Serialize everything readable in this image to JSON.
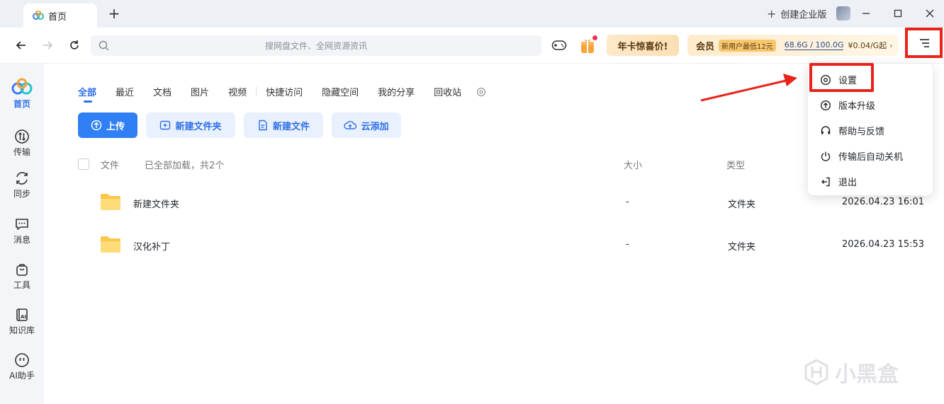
{
  "window": {
    "tab_title": "首页",
    "new_tab": "+",
    "enterprise_label": "创建企业版"
  },
  "toolbar": {
    "search_placeholder": "搜网盘文件、全网资源资讯",
    "promo_label": "年卡惊喜价!",
    "member_label": "会员",
    "member_badge": "新用户最低12元",
    "quota": "68.6G / 100.0G",
    "price": "¥0.04/G起",
    "arrow": "›"
  },
  "sidebar": {
    "items": [
      {
        "label": "首页",
        "icon": "cloud-logo-icon",
        "active": true
      },
      {
        "label": "传输",
        "icon": "transfer-icon"
      },
      {
        "label": "同步",
        "icon": "sync-icon"
      },
      {
        "label": "消息",
        "icon": "message-icon"
      },
      {
        "label": "工具",
        "icon": "toolbox-icon"
      },
      {
        "label": "知识库",
        "icon": "knowledge-base-icon"
      },
      {
        "label": "AI助手",
        "icon": "ai-assistant-icon"
      }
    ]
  },
  "content_tabs": [
    "全部",
    "最近",
    "文档",
    "图片",
    "视频",
    "快捷访问",
    "隐藏空间",
    "我的分享",
    "回收站"
  ],
  "actions": {
    "upload": "上传",
    "new_folder": "新建文件夹",
    "new_file": "新建文件",
    "cloud_add": "云添加"
  },
  "list": {
    "col_file": "文件",
    "status": "已全部加载，共2个",
    "col_size": "大小",
    "col_type": "类型",
    "rows": [
      {
        "name": "新建文件夹",
        "size": "-",
        "type": "文件夹",
        "date": "2026.04.23 16:01"
      },
      {
        "name": "汉化补丁",
        "size": "-",
        "type": "文件夹",
        "date": "2026.04.23 15:53"
      }
    ]
  },
  "menu": {
    "items": [
      {
        "label": "设置",
        "icon": "settings-icon"
      },
      {
        "label": "版本升级",
        "icon": "upgrade-icon"
      },
      {
        "label": "帮助与反馈",
        "icon": "headset-icon"
      },
      {
        "label": "传输后自动关机",
        "icon": "power-icon"
      },
      {
        "label": "退出",
        "icon": "logout-icon"
      }
    ]
  },
  "watermark": "小黑盒",
  "colors": {
    "accent": "#2f7ff5",
    "highlight": "#e8241a"
  }
}
